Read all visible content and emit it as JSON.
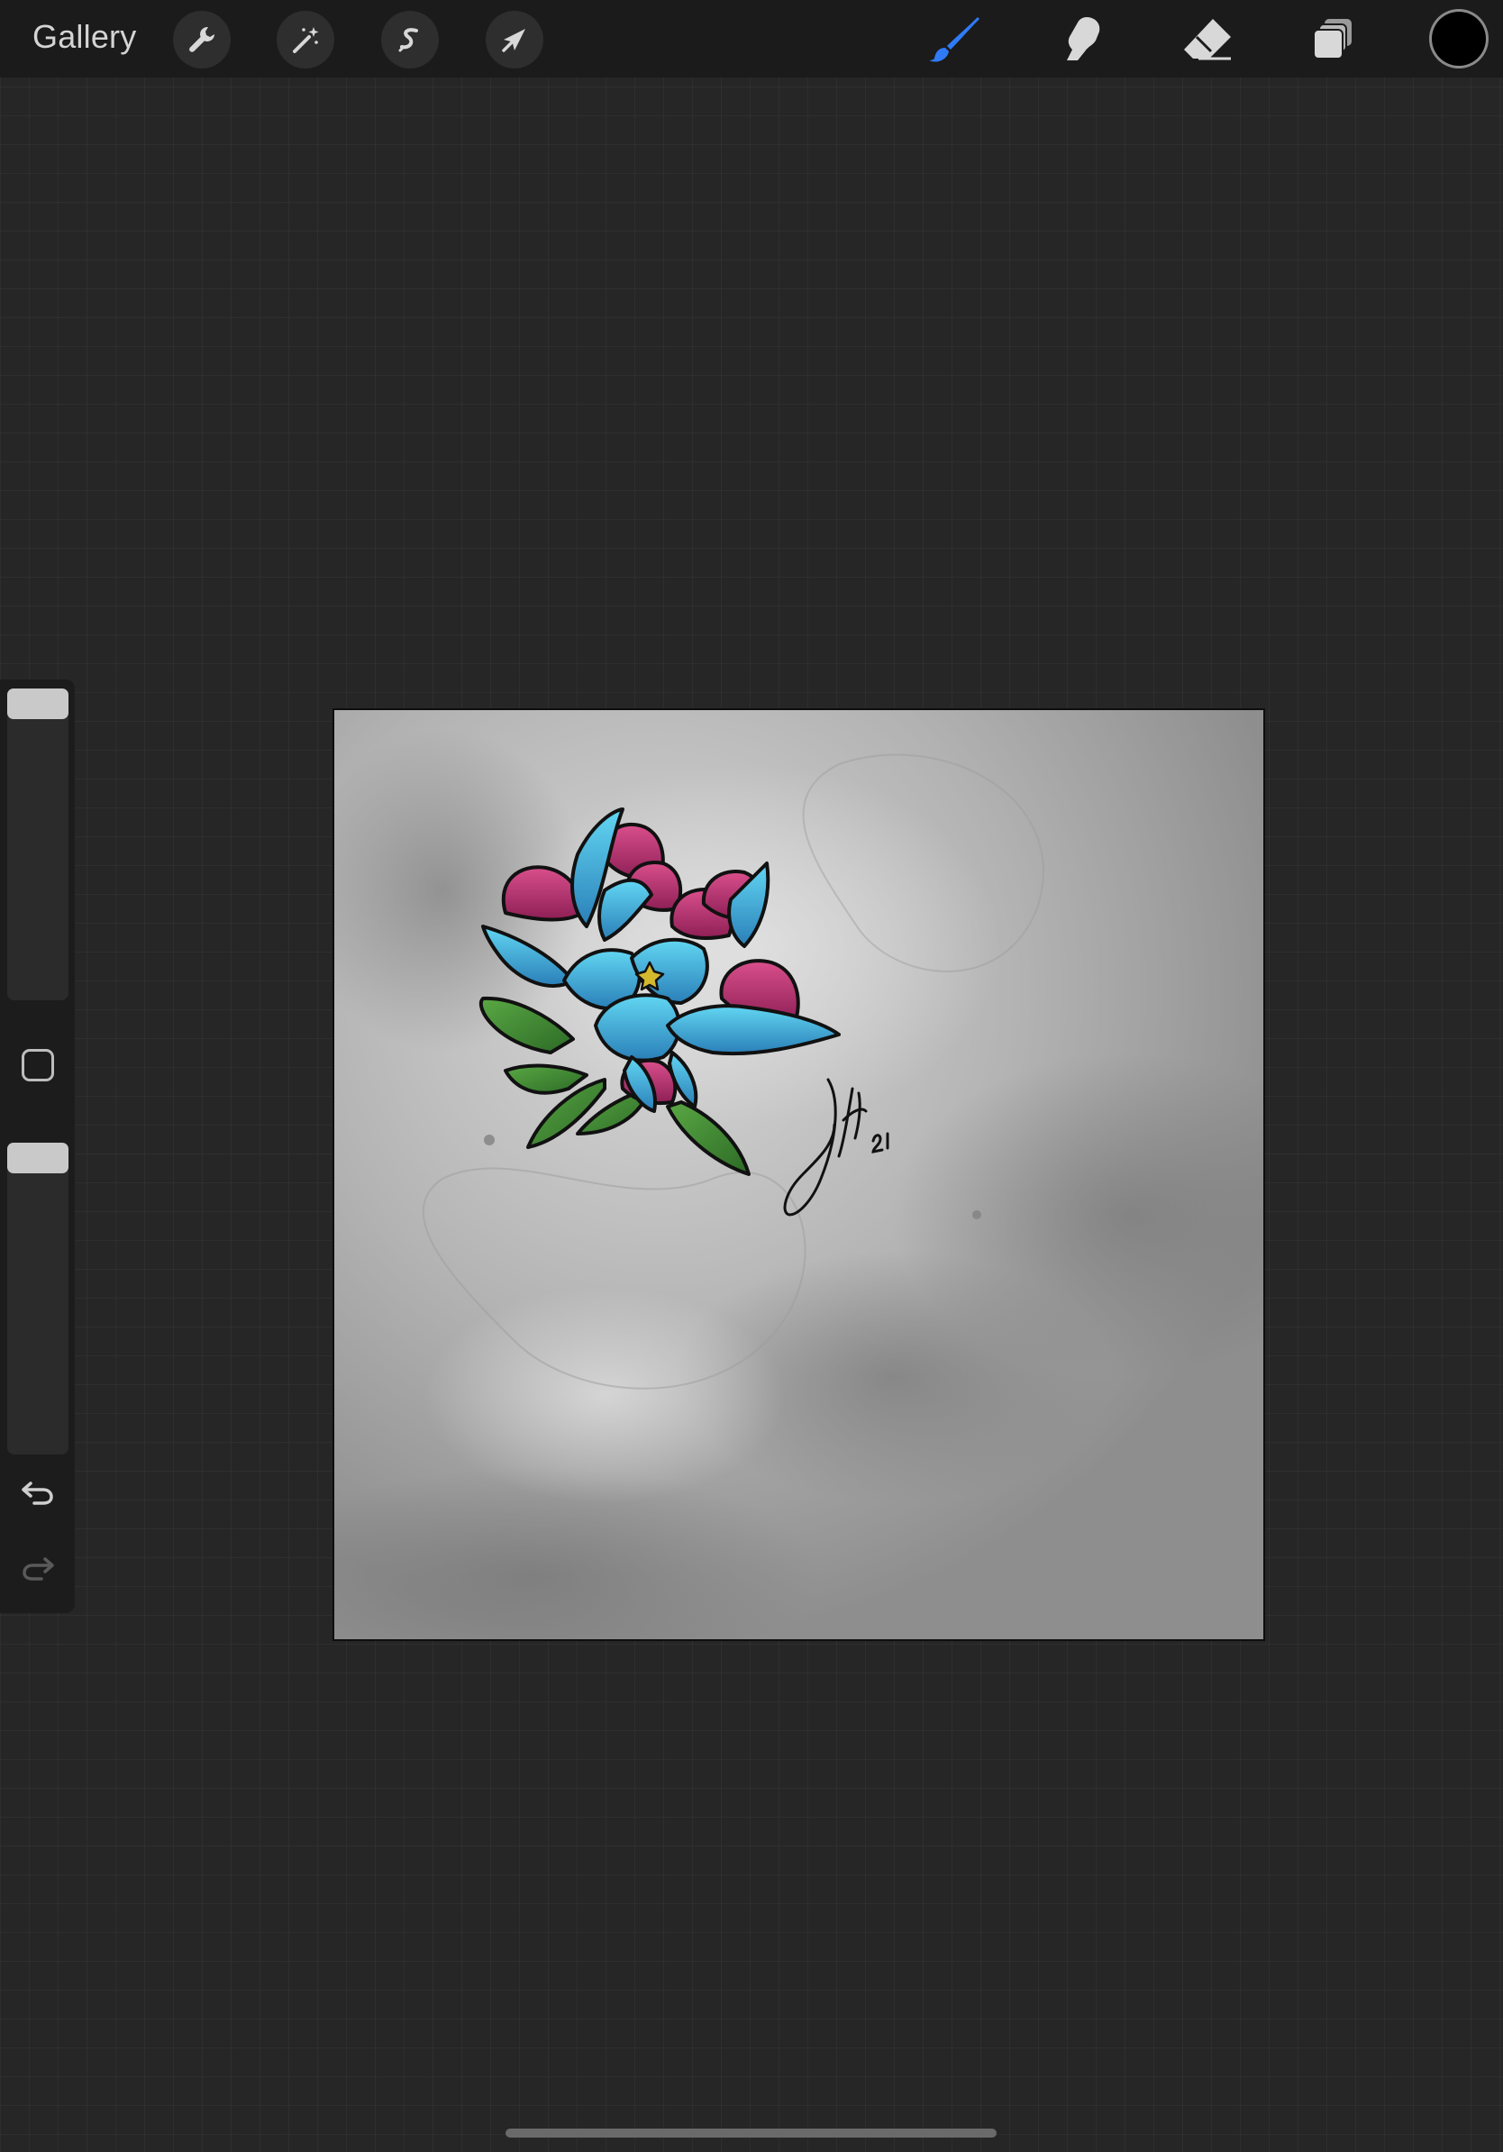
{
  "toolbar": {
    "gallery_label": "Gallery",
    "left_tools": [
      {
        "name": "actions",
        "icon": "wrench-icon"
      },
      {
        "name": "adjustments",
        "icon": "magic-wand-icon"
      },
      {
        "name": "selection",
        "icon": "selection-s-icon"
      },
      {
        "name": "transform",
        "icon": "arrow-cursor-icon"
      }
    ],
    "right_tools": [
      {
        "name": "brush",
        "icon": "brush-icon",
        "active": true
      },
      {
        "name": "smudge",
        "icon": "smudge-finger-icon",
        "active": false
      },
      {
        "name": "eraser",
        "icon": "eraser-icon",
        "active": false
      },
      {
        "name": "layers",
        "icon": "layers-icon",
        "active": false
      }
    ],
    "current_color": "#000000",
    "active_tool_color": "#2f7bf6"
  },
  "sidebar": {
    "brush_size_level": 1.0,
    "brush_opacity_level": 1.0,
    "modify_button": "square-icon",
    "undo": "undo-icon",
    "redo": "redo-icon"
  },
  "canvas": {
    "artwork": "peony-flower-illustration",
    "signature": "artist-signature",
    "colors": {
      "petal_blue": "#4cc3e6",
      "petal_pink": "#c23a78",
      "leaf_green": "#3f8a34",
      "background_gray": "#a9a9a9"
    }
  }
}
